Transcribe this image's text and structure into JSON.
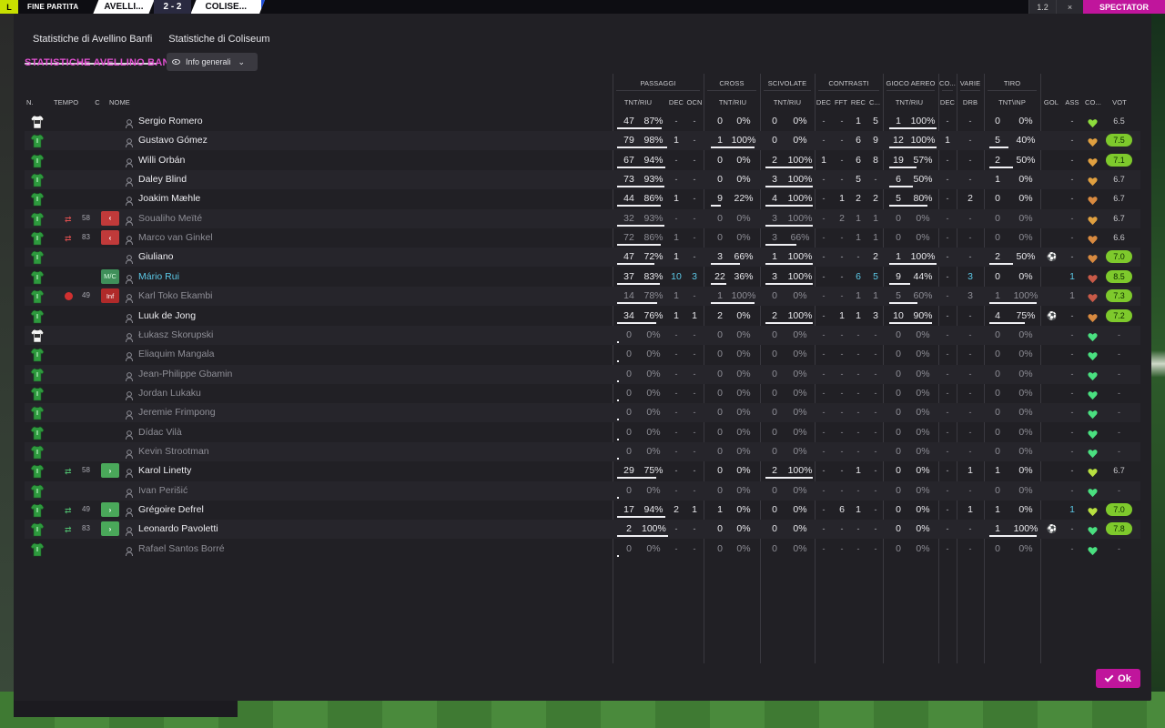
{
  "topbar": {
    "logo": "L",
    "status_label": "FINE PARTITA",
    "home_team": "AVELLI...",
    "score": "2 - 2",
    "away_team": "COLISE...",
    "zoom": "1.2",
    "close": "×",
    "spectator": "SPECTATOR"
  },
  "tabs": [
    {
      "label": "Statistiche di Avellino Banfi",
      "active": true
    },
    {
      "label": "Statistiche di Coliseum",
      "active": false
    }
  ],
  "section_title": "STATISTICHE AVELLINO BANFI",
  "view_dropdown": {
    "label": "Info generali",
    "icon": "eye-icon"
  },
  "groups": {
    "passaggi": "PASSAGGI",
    "cross": "CROSS",
    "scivolate": "SCIVOLATE",
    "contrasti": "CONTRASTI",
    "gioco_aereo": "GIOCO AEREO",
    "co": "CO...",
    "varie": "VARIE",
    "tiro": "TIRO"
  },
  "columns": {
    "n": "N.",
    "tempo": "TEMPO",
    "c": "C",
    "nome": "NOME",
    "pass_tnt": "TNT/RIU",
    "pass_dec": "DEC",
    "pass_ocn": "OCN",
    "cross_tnt": "TNT/RIU",
    "sciv_tnt": "TNT/RIU",
    "contr_dec": "DEC",
    "contr_fft": "FFT",
    "contr_rec": "REC",
    "contr_c": "C...",
    "aereo_tnt": "TNT/RIU",
    "co_dec": "DEC",
    "varie_drb": "DRB",
    "tiro_tnt": "TNT\\INP",
    "gol": "GOL",
    "ass": "ASS",
    "cond": "CO...",
    "vot": "VOT"
  },
  "players": [
    {
      "shirt": "gk",
      "sub": "",
      "min": "",
      "role": "",
      "name": "Sergio Romero",
      "dim": false,
      "p": [
        "47",
        "87%"
      ],
      "pd": "-",
      "po": "-",
      "c": [
        "0",
        "0%"
      ],
      "s": [
        "0",
        "0%"
      ],
      "k": [
        "-",
        "-",
        "1",
        "5"
      ],
      "a": [
        "1",
        "100%"
      ],
      "cd": "-",
      "drb": "-",
      "t": [
        "0",
        "0%"
      ],
      "gol": "",
      "ass": "-",
      "heart": "#8ddc3c",
      "vot": "6.5",
      "vg": false
    },
    {
      "shirt": "out",
      "sub": "",
      "min": "",
      "role": "",
      "name": "Gustavo Gómez",
      "dim": false,
      "p": [
        "79",
        "98%"
      ],
      "pd": "1",
      "po": "-",
      "c": [
        "1",
        "100%"
      ],
      "s": [
        "0",
        "0%"
      ],
      "k": [
        "-",
        "-",
        "6",
        "9"
      ],
      "a": [
        "12",
        "100%"
      ],
      "cd": "1",
      "drb": "-",
      "t": [
        "5",
        "40%"
      ],
      "gol": "",
      "ass": "-",
      "heart": "#e0a040",
      "vot": "7.5",
      "vg": true
    },
    {
      "shirt": "out",
      "sub": "",
      "min": "",
      "role": "",
      "name": "Willi Orbán",
      "dim": false,
      "p": [
        "67",
        "94%"
      ],
      "pd": "-",
      "po": "-",
      "c": [
        "0",
        "0%"
      ],
      "s": [
        "2",
        "100%"
      ],
      "k": [
        "1",
        "-",
        "6",
        "8"
      ],
      "a": [
        "19",
        "57%"
      ],
      "cd": "-",
      "drb": "-",
      "t": [
        "2",
        "50%"
      ],
      "gol": "",
      "ass": "-",
      "heart": "#e0a040",
      "vot": "7.1",
      "vg": true
    },
    {
      "shirt": "out",
      "sub": "",
      "min": "",
      "role": "",
      "name": "Daley Blind",
      "dim": false,
      "p": [
        "73",
        "93%"
      ],
      "pd": "-",
      "po": "-",
      "c": [
        "0",
        "0%"
      ],
      "s": [
        "3",
        "100%"
      ],
      "k": [
        "-",
        "-",
        "5",
        "-"
      ],
      "a": [
        "6",
        "50%"
      ],
      "cd": "-",
      "drb": "-",
      "t": [
        "1",
        "0%"
      ],
      "gol": "",
      "ass": "-",
      "heart": "#e0a040",
      "vot": "6.7",
      "vg": false
    },
    {
      "shirt": "out",
      "sub": "",
      "min": "",
      "role": "",
      "name": "Joakim Mæhle",
      "dim": false,
      "p": [
        "44",
        "86%"
      ],
      "pd": "1",
      "po": "-",
      "c": [
        "9",
        "22%"
      ],
      "s": [
        "4",
        "100%"
      ],
      "k": [
        "-",
        "1",
        "2",
        "2"
      ],
      "a": [
        "5",
        "80%"
      ],
      "cd": "-",
      "drb": "2",
      "t": [
        "0",
        "0%"
      ],
      "gol": "",
      "ass": "-",
      "heart": "#d88a40",
      "vot": "6.7",
      "vg": false
    },
    {
      "shirt": "out",
      "sub": "out",
      "min": "58",
      "role": "red",
      "name": "Soualiho Meïté",
      "dim": true,
      "p": [
        "32",
        "93%"
      ],
      "pd": "-",
      "po": "-",
      "c": [
        "0",
        "0%"
      ],
      "s": [
        "3",
        "100%"
      ],
      "k": [
        "-",
        "2",
        "1",
        "1"
      ],
      "a": [
        "0",
        "0%"
      ],
      "cd": "-",
      "drb": "-",
      "t": [
        "0",
        "0%"
      ],
      "gol": "",
      "ass": "-",
      "heart": "#e0a040",
      "vot": "6.7",
      "vg": false
    },
    {
      "shirt": "out",
      "sub": "out",
      "min": "83",
      "role": "red",
      "name": "Marco van Ginkel",
      "dim": true,
      "p": [
        "72",
        "86%"
      ],
      "pd": "1",
      "po": "-",
      "c": [
        "0",
        "0%"
      ],
      "s": [
        "3",
        "66%"
      ],
      "k": [
        "-",
        "-",
        "1",
        "1"
      ],
      "a": [
        "0",
        "0%"
      ],
      "cd": "-",
      "drb": "-",
      "t": [
        "0",
        "0%"
      ],
      "gol": "",
      "ass": "-",
      "heart": "#d88a40",
      "vot": "6.6",
      "vg": false
    },
    {
      "shirt": "out",
      "sub": "",
      "min": "",
      "role": "",
      "name": "Giuliano",
      "dim": false,
      "p": [
        "47",
        "72%"
      ],
      "pd": "1",
      "po": "-",
      "c": [
        "3",
        "66%"
      ],
      "s": [
        "1",
        "100%"
      ],
      "k": [
        "-",
        "-",
        "-",
        "2"
      ],
      "a": [
        "1",
        "100%"
      ],
      "cd": "-",
      "drb": "-",
      "t": [
        "2",
        "50%"
      ],
      "gol": "ball",
      "ass": "-",
      "heart": "#d88a40",
      "vot": "7.0",
      "vg": true
    },
    {
      "shirt": "out",
      "sub": "",
      "min": "",
      "role": "mc",
      "name": "Mário Rui",
      "dim": false,
      "cyan": true,
      "p": [
        "37",
        "83%"
      ],
      "pd": "10",
      "po": "3",
      "c": [
        "22",
        "36%"
      ],
      "s": [
        "3",
        "100%"
      ],
      "k": [
        "-",
        "-",
        "6",
        "5"
      ],
      "a": [
        "9",
        "44%"
      ],
      "cd": "-",
      "drb": "3",
      "t": [
        "0",
        "0%"
      ],
      "gol": "",
      "ass": "1",
      "heart": "#c85a48",
      "vot": "8.5",
      "vg": true
    },
    {
      "shirt": "out",
      "sub": "inj",
      "min": "49",
      "role": "inf",
      "name": "Karl Toko Ekambi",
      "dim": true,
      "p": [
        "14",
        "78%"
      ],
      "pd": "1",
      "po": "-",
      "c": [
        "1",
        "100%"
      ],
      "s": [
        "0",
        "0%"
      ],
      "k": [
        "-",
        "-",
        "1",
        "1"
      ],
      "a": [
        "5",
        "60%"
      ],
      "cd": "-",
      "drb": "3",
      "t": [
        "1",
        "100%"
      ],
      "gol": "",
      "ass": "1",
      "heart": "#c85a48",
      "vot": "7.3",
      "vg": true
    },
    {
      "shirt": "out",
      "sub": "",
      "min": "",
      "role": "",
      "name": "Luuk de Jong",
      "dim": false,
      "p": [
        "34",
        "76%"
      ],
      "pd": "1",
      "po": "1",
      "c": [
        "2",
        "0%"
      ],
      "s": [
        "2",
        "100%"
      ],
      "k": [
        "-",
        "1",
        "1",
        "3"
      ],
      "a": [
        "10",
        "90%"
      ],
      "cd": "-",
      "drb": "-",
      "t": [
        "4",
        "75%"
      ],
      "gol": "ball",
      "ass": "-",
      "heart": "#d88a40",
      "vot": "7.2",
      "vg": true
    },
    {
      "shirt": "gk",
      "sub": "",
      "min": "",
      "role": "",
      "name": "Łukasz Skorupski",
      "dim": true,
      "p": [
        "0",
        "0%"
      ],
      "pd": "-",
      "po": "-",
      "c": [
        "0",
        "0%"
      ],
      "s": [
        "0",
        "0%"
      ],
      "k": [
        "-",
        "-",
        "-",
        "-"
      ],
      "a": [
        "0",
        "0%"
      ],
      "cd": "-",
      "drb": "-",
      "t": [
        "0",
        "0%"
      ],
      "gol": "",
      "ass": "-",
      "heart": "#4ae080",
      "vot": "-",
      "vg": false
    },
    {
      "shirt": "out",
      "sub": "",
      "min": "",
      "role": "",
      "name": "Eliaquim Mangala",
      "dim": true,
      "p": [
        "0",
        "0%"
      ],
      "pd": "-",
      "po": "-",
      "c": [
        "0",
        "0%"
      ],
      "s": [
        "0",
        "0%"
      ],
      "k": [
        "-",
        "-",
        "-",
        "-"
      ],
      "a": [
        "0",
        "0%"
      ],
      "cd": "-",
      "drb": "-",
      "t": [
        "0",
        "0%"
      ],
      "gol": "",
      "ass": "-",
      "heart": "#4ae080",
      "vot": "-",
      "vg": false
    },
    {
      "shirt": "out",
      "sub": "",
      "min": "",
      "role": "",
      "name": "Jean-Philippe Gbamin",
      "dim": true,
      "p": [
        "0",
        "0%"
      ],
      "pd": "-",
      "po": "-",
      "c": [
        "0",
        "0%"
      ],
      "s": [
        "0",
        "0%"
      ],
      "k": [
        "-",
        "-",
        "-",
        "-"
      ],
      "a": [
        "0",
        "0%"
      ],
      "cd": "-",
      "drb": "-",
      "t": [
        "0",
        "0%"
      ],
      "gol": "",
      "ass": "-",
      "heart": "#4ae080",
      "vot": "-",
      "vg": false
    },
    {
      "shirt": "out",
      "sub": "",
      "min": "",
      "role": "",
      "name": "Jordan Lukaku",
      "dim": true,
      "p": [
        "0",
        "0%"
      ],
      "pd": "-",
      "po": "-",
      "c": [
        "0",
        "0%"
      ],
      "s": [
        "0",
        "0%"
      ],
      "k": [
        "-",
        "-",
        "-",
        "-"
      ],
      "a": [
        "0",
        "0%"
      ],
      "cd": "-",
      "drb": "-",
      "t": [
        "0",
        "0%"
      ],
      "gol": "",
      "ass": "-",
      "heart": "#4ae080",
      "vot": "-",
      "vg": false
    },
    {
      "shirt": "out",
      "sub": "",
      "min": "",
      "role": "",
      "name": "Jeremie Frimpong",
      "dim": true,
      "p": [
        "0",
        "0%"
      ],
      "pd": "-",
      "po": "-",
      "c": [
        "0",
        "0%"
      ],
      "s": [
        "0",
        "0%"
      ],
      "k": [
        "-",
        "-",
        "-",
        "-"
      ],
      "a": [
        "0",
        "0%"
      ],
      "cd": "-",
      "drb": "-",
      "t": [
        "0",
        "0%"
      ],
      "gol": "",
      "ass": "-",
      "heart": "#4ae080",
      "vot": "-",
      "vg": false
    },
    {
      "shirt": "out",
      "sub": "",
      "min": "",
      "role": "",
      "name": "Dídac Vilà",
      "dim": true,
      "p": [
        "0",
        "0%"
      ],
      "pd": "-",
      "po": "-",
      "c": [
        "0",
        "0%"
      ],
      "s": [
        "0",
        "0%"
      ],
      "k": [
        "-",
        "-",
        "-",
        "-"
      ],
      "a": [
        "0",
        "0%"
      ],
      "cd": "-",
      "drb": "-",
      "t": [
        "0",
        "0%"
      ],
      "gol": "",
      "ass": "-",
      "heart": "#4ae080",
      "vot": "-",
      "vg": false
    },
    {
      "shirt": "out",
      "sub": "",
      "min": "",
      "role": "",
      "name": "Kevin Strootman",
      "dim": true,
      "p": [
        "0",
        "0%"
      ],
      "pd": "-",
      "po": "-",
      "c": [
        "0",
        "0%"
      ],
      "s": [
        "0",
        "0%"
      ],
      "k": [
        "-",
        "-",
        "-",
        "-"
      ],
      "a": [
        "0",
        "0%"
      ],
      "cd": "-",
      "drb": "-",
      "t": [
        "0",
        "0%"
      ],
      "gol": "",
      "ass": "-",
      "heart": "#4ae080",
      "vot": "-",
      "vg": false
    },
    {
      "shirt": "out",
      "sub": "in",
      "min": "58",
      "role": "green",
      "name": "Karol Linetty",
      "dim": false,
      "p": [
        "29",
        "75%"
      ],
      "pd": "-",
      "po": "-",
      "c": [
        "0",
        "0%"
      ],
      "s": [
        "2",
        "100%"
      ],
      "k": [
        "-",
        "-",
        "1",
        "-"
      ],
      "a": [
        "0",
        "0%"
      ],
      "cd": "-",
      "drb": "1",
      "t": [
        "1",
        "0%"
      ],
      "gol": "",
      "ass": "-",
      "heart": "#b8e040",
      "vot": "6.7",
      "vg": false
    },
    {
      "shirt": "out",
      "sub": "",
      "min": "",
      "role": "",
      "name": "Ivan Perišić",
      "dim": true,
      "p": [
        "0",
        "0%"
      ],
      "pd": "-",
      "po": "-",
      "c": [
        "0",
        "0%"
      ],
      "s": [
        "0",
        "0%"
      ],
      "k": [
        "-",
        "-",
        "-",
        "-"
      ],
      "a": [
        "0",
        "0%"
      ],
      "cd": "-",
      "drb": "-",
      "t": [
        "0",
        "0%"
      ],
      "gol": "",
      "ass": "-",
      "heart": "#4ae080",
      "vot": "-",
      "vg": false
    },
    {
      "shirt": "out",
      "sub": "in",
      "min": "49",
      "role": "green",
      "name": "Grégoire Defrel",
      "dim": false,
      "p": [
        "17",
        "94%"
      ],
      "pd": "2",
      "po": "1",
      "c": [
        "1",
        "0%"
      ],
      "s": [
        "0",
        "0%"
      ],
      "k": [
        "-",
        "6",
        "1",
        "-"
      ],
      "a": [
        "0",
        "0%"
      ],
      "cd": "-",
      "drb": "1",
      "t": [
        "1",
        "0%"
      ],
      "gol": "",
      "ass": "1",
      "heart": "#b8e040",
      "vot": "7.0",
      "vg": true
    },
    {
      "shirt": "out",
      "sub": "in",
      "min": "83",
      "role": "green",
      "name": "Leonardo Pavoletti",
      "dim": false,
      "p": [
        "2",
        "100%"
      ],
      "pd": "-",
      "po": "-",
      "c": [
        "0",
        "0%"
      ],
      "s": [
        "0",
        "0%"
      ],
      "k": [
        "-",
        "-",
        "-",
        "-"
      ],
      "a": [
        "0",
        "0%"
      ],
      "cd": "-",
      "drb": "-",
      "t": [
        "1",
        "100%"
      ],
      "gol": "ball",
      "ass": "-",
      "heart": "#4ae080",
      "vot": "7.8",
      "vg": true
    },
    {
      "shirt": "out",
      "sub": "",
      "min": "",
      "role": "",
      "name": "Rafael Santos Borré",
      "dim": true,
      "p": [
        "0",
        "0%"
      ],
      "pd": "-",
      "po": "-",
      "c": [
        "0",
        "0%"
      ],
      "s": [
        "0",
        "0%"
      ],
      "k": [
        "-",
        "-",
        "-",
        "-"
      ],
      "a": [
        "0",
        "0%"
      ],
      "cd": "-",
      "drb": "-",
      "t": [
        "0",
        "0%"
      ],
      "gol": "",
      "ass": "-",
      "heart": "#4ae080",
      "vot": "-",
      "vg": false
    }
  ],
  "role_labels": {
    "mc": "M/C",
    "inf": "Inf"
  },
  "ok_button": "Ok",
  "colors": {
    "accent": "#c0159c",
    "title": "#e04fd0",
    "cyan": "#5bc8e6",
    "vote_green": "#7ec92c"
  }
}
